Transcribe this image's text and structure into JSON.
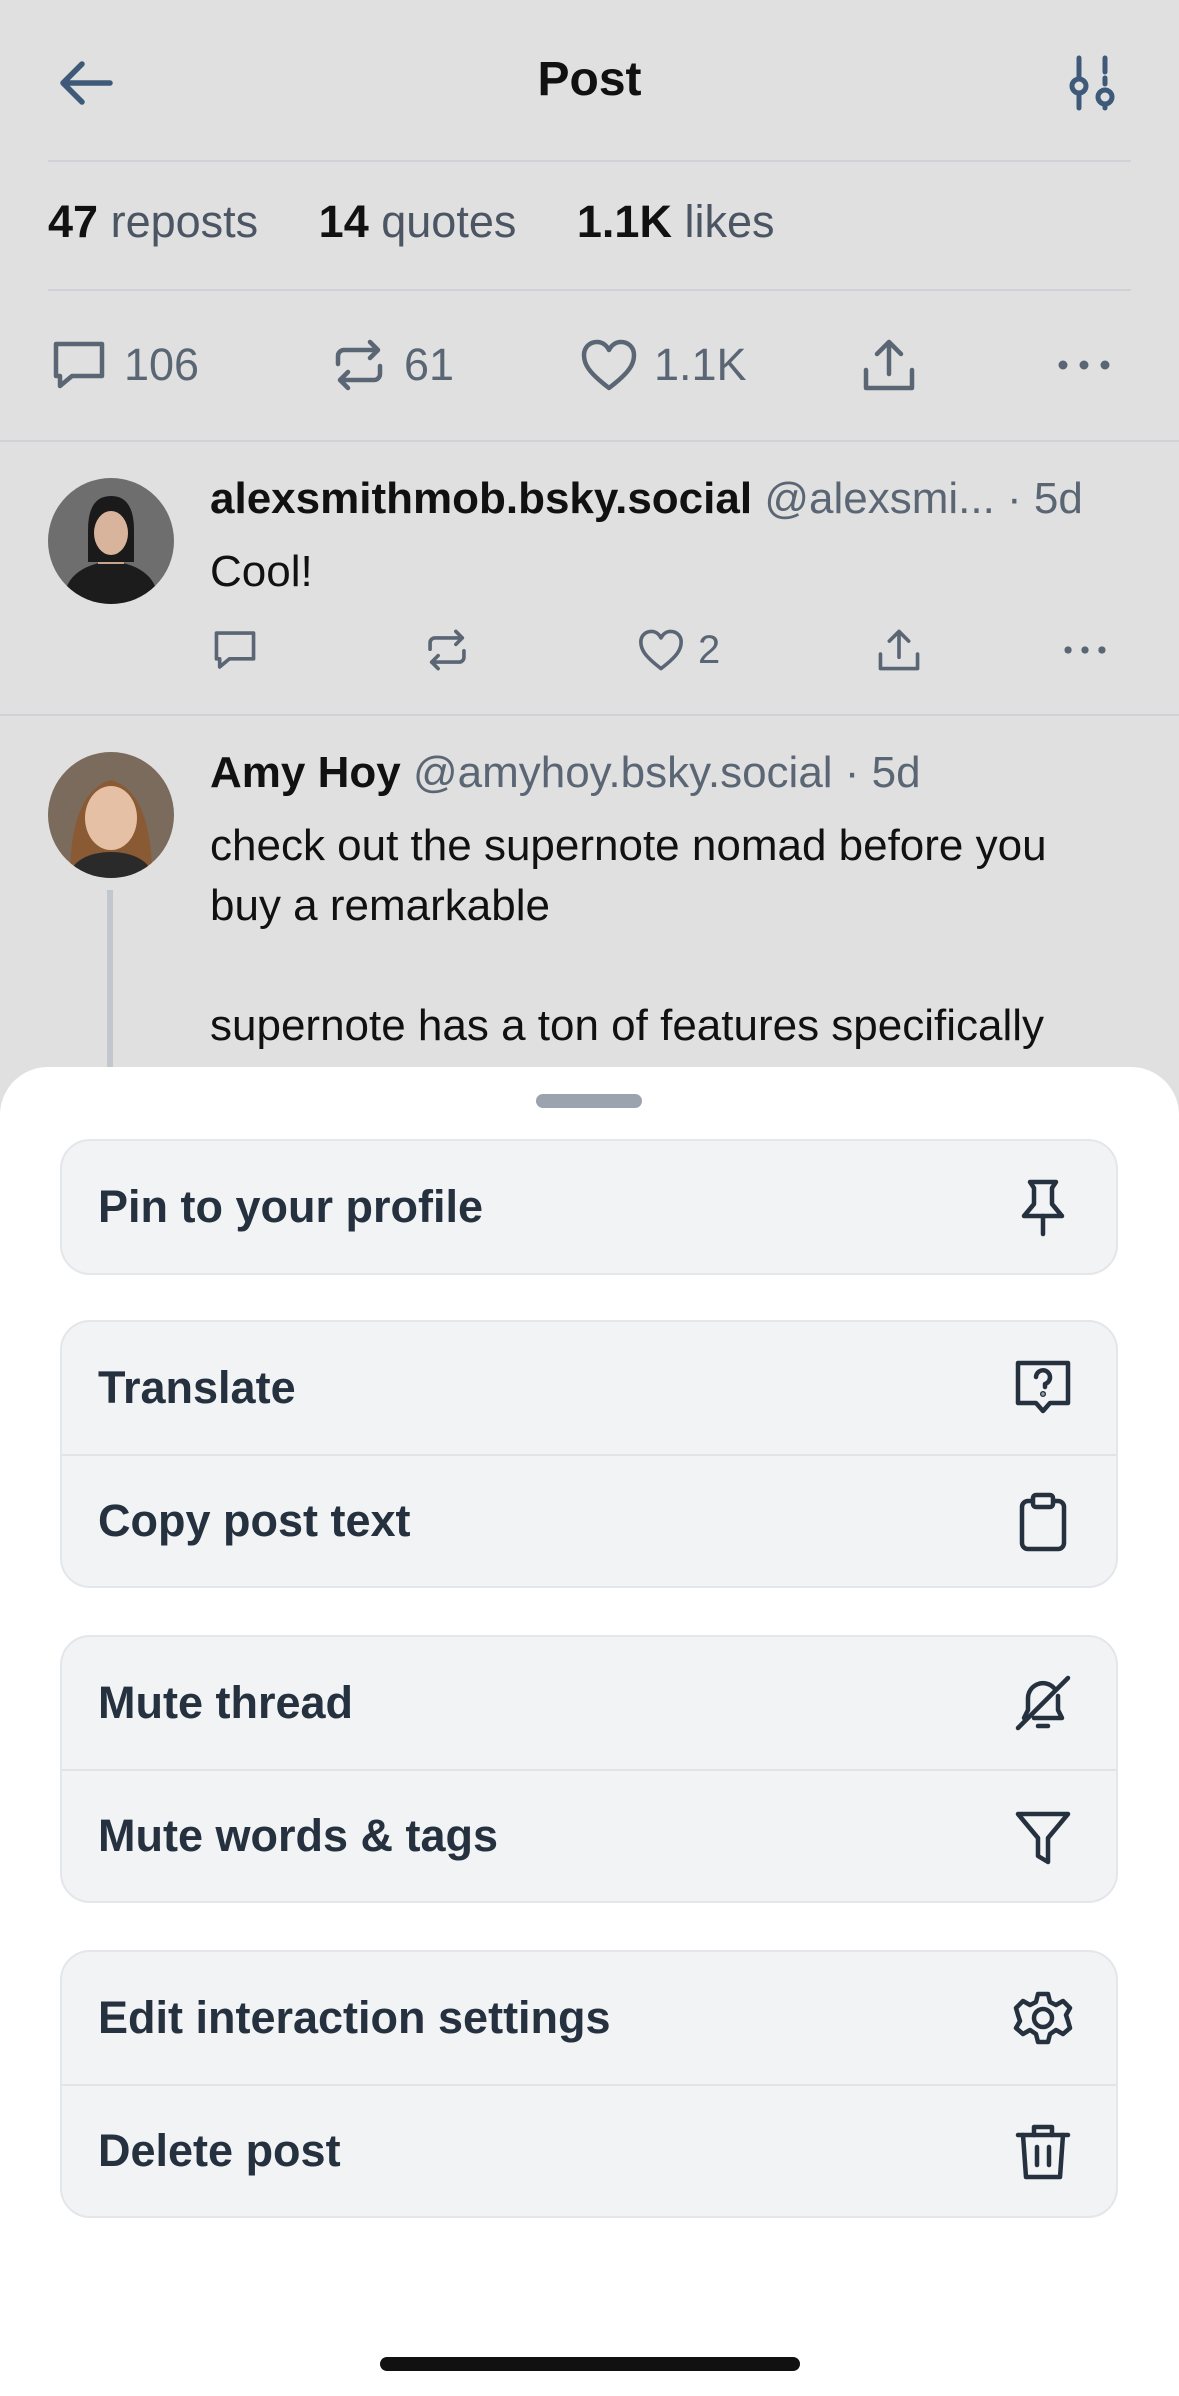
{
  "header": {
    "title": "Post",
    "back_icon": "arrow-left-icon",
    "filter_icon": "sliders-icon"
  },
  "stats": [
    {
      "num": "47",
      "label": "reposts"
    },
    {
      "num": "14",
      "label": "quotes"
    },
    {
      "num": "1.1K",
      "label": "likes"
    }
  ],
  "post_actions": {
    "replies": "106",
    "reposts": "61",
    "likes": "1.1K"
  },
  "replies": [
    {
      "name": "alexsmithmob.bsky.social",
      "handle": "@alexsmi...",
      "time": " · 5d",
      "text": "Cool!",
      "likes": "2"
    },
    {
      "name": "Amy Hoy",
      "handle": "@amyhoy.bsky.social · 5d",
      "text_line1": "check out the supernote nomad before you",
      "text_line2": "buy a remarkable",
      "text_line3": "supernote has a ton of features specifically"
    }
  ],
  "sheet": {
    "groups": [
      [
        {
          "label": "Pin to your profile",
          "icon": "pin-icon"
        }
      ],
      [
        {
          "label": "Translate",
          "icon": "translate-icon"
        },
        {
          "label": "Copy post text",
          "icon": "clipboard-icon"
        }
      ],
      [
        {
          "label": "Mute thread",
          "icon": "bell-slash-icon"
        },
        {
          "label": "Mute words & tags",
          "icon": "filter-icon"
        }
      ],
      [
        {
          "label": "Edit interaction settings",
          "icon": "gear-icon"
        },
        {
          "label": "Delete post",
          "icon": "trash-icon"
        }
      ]
    ]
  },
  "colors": {
    "sheet_bg": "#ffffff",
    "item_bg": "#f1f3f5",
    "dim_bg": "#e0e0e0",
    "text": "#25313e"
  }
}
